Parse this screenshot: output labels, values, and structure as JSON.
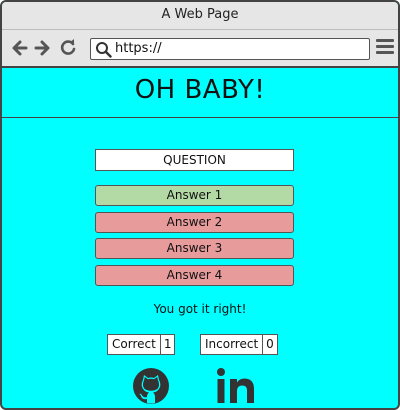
{
  "window": {
    "title": "A Web Page"
  },
  "toolbar": {
    "url": "https://"
  },
  "header": {
    "title": "OH BABY!"
  },
  "quiz": {
    "question": "QUESTION",
    "answers": [
      {
        "label": "Answer 1",
        "color": "#b3d9a5"
      },
      {
        "label": "Answer 2",
        "color": "#e79b9b"
      },
      {
        "label": "Answer 3",
        "color": "#e79b9b"
      },
      {
        "label": "Answer 4",
        "color": "#e79b9b"
      }
    ],
    "result": "You got it right!"
  },
  "score": {
    "correct_label": "Correct",
    "correct_value": "1",
    "incorrect_label": "Incorrect",
    "incorrect_value": "0"
  },
  "social": [
    {
      "icon": "github-icon"
    },
    {
      "icon": "linkedin-icon"
    }
  ],
  "colors": {
    "background": "#00ffff"
  }
}
